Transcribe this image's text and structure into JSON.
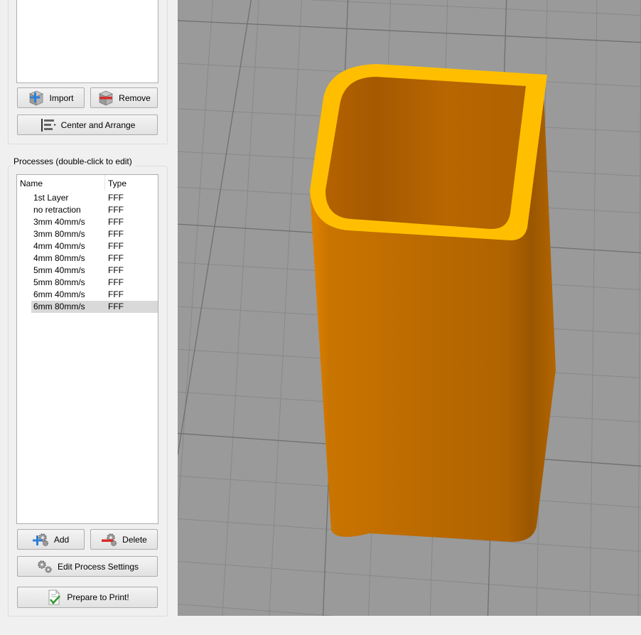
{
  "models": {
    "import_label": "Import",
    "remove_label": "Remove",
    "center_arrange_label": "Center and Arrange"
  },
  "processes": {
    "group_title": "Processes (double-click to edit)",
    "columns": {
      "name": "Name",
      "type": "Type"
    },
    "items": [
      {
        "name": "1st Layer",
        "type": "FFF"
      },
      {
        "name": "no retraction",
        "type": "FFF"
      },
      {
        "name": "3mm 40mm/s",
        "type": "FFF"
      },
      {
        "name": "3mm 80mm/s",
        "type": "FFF"
      },
      {
        "name": "4mm 40mm/s",
        "type": "FFF"
      },
      {
        "name": "4mm 80mm/s",
        "type": "FFF"
      },
      {
        "name": "5mm 40mm/s",
        "type": "FFF"
      },
      {
        "name": "5mm 80mm/s",
        "type": "FFF"
      },
      {
        "name": "6mm 40mm/s",
        "type": "FFF"
      },
      {
        "name": "6mm 80mm/s",
        "type": "FFF"
      }
    ],
    "selected_index": 9,
    "add_label": "Add",
    "delete_label": "Delete",
    "edit_label": "Edit Process Settings",
    "prepare_label": "Prepare to Print!"
  },
  "colors": {
    "model_side": "#d07a00",
    "model_rim": "#ffbf00",
    "model_inner": "#b86500",
    "bed": "#9a9a9a",
    "grid": "#7f7f7f"
  },
  "icons": {
    "import": "import-cube-icon",
    "remove": "remove-cube-icon",
    "arrange": "arrange-icon",
    "add": "add-gears-icon",
    "delete": "delete-gears-icon",
    "edit": "gears-icon",
    "prepare": "document-check-icon"
  }
}
